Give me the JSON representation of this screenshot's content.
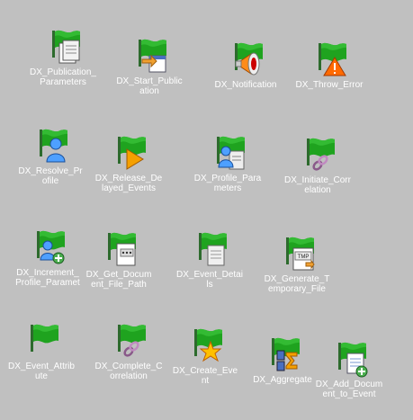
{
  "window": {
    "background": "#c0c0c0"
  },
  "colors": {
    "flag_green": "#1fa31f",
    "flag_pole": "#2d6b2d",
    "label": "#ffffff"
  },
  "items": [
    {
      "name": "DX_Publication_Parameters",
      "label": "DX_Publication_\nParameters",
      "badge": "doc-stack-icon"
    },
    {
      "name": "DX_Start_Publication",
      "label": "DX_Start_Public\nation",
      "badge": "doc-arrow-icon"
    },
    {
      "name": "DX_Notification",
      "label": "DX_Notification",
      "badge": "megaphone-icon"
    },
    {
      "name": "DX_Throw_Error",
      "label": "DX_Throw_Error",
      "badge": "warning-triangle-icon"
    },
    {
      "name": "DX_Resolve_Profile",
      "label": "DX_Resolve_Pr\nofile",
      "badge": "person-icon"
    },
    {
      "name": "DX_Release_Delayed_Events",
      "label": "DX_Release_De\nlayed_Events",
      "badge": "play-arrow-icon"
    },
    {
      "name": "DX_Profile_Parameters",
      "label": "DX_Profile_Para\nmeters",
      "badge": "person-doc-icon"
    },
    {
      "name": "DX_Initiate_Correlation",
      "label": "DX_Initiate_Corr\nelation",
      "badge": "chain-link-icon"
    },
    {
      "name": "DX_Increment_Profile_Parameter",
      "label": "DX_Increment_\nProfile_Paramet",
      "badge": "person-plus-icon"
    },
    {
      "name": "DX_Get_Document_File_Path",
      "label": "DX_Get_Docum\nent_File_Path",
      "badge": "doc-dots-icon"
    },
    {
      "name": "DX_Event_Details",
      "label": "DX_Event_Detai\nls",
      "badge": "doc-icon"
    },
    {
      "name": "DX_Generate_Temporary_File",
      "label": "DX_Generate_T\nemporary_File",
      "badge": "tmp-file-icon"
    },
    {
      "name": "DX_Event_Attribute",
      "label": "DX_Event_Attrib\nute",
      "badge": "none"
    },
    {
      "name": "DX_Complete_Correlation",
      "label": "DX_Complete_C\norrelation",
      "badge": "chain-link-icon"
    },
    {
      "name": "DX_Create_Event",
      "label": "DX_Create_Eve\nnt",
      "badge": "star-burst-icon"
    },
    {
      "name": "DX_Aggregate",
      "label": "DX_Aggregate",
      "badge": "sigma-icon"
    },
    {
      "name": "DX_Add_Document_to_Event",
      "label": "DX_Add_Docum\nent_to_Event",
      "badge": "doc-plus-icon"
    }
  ]
}
